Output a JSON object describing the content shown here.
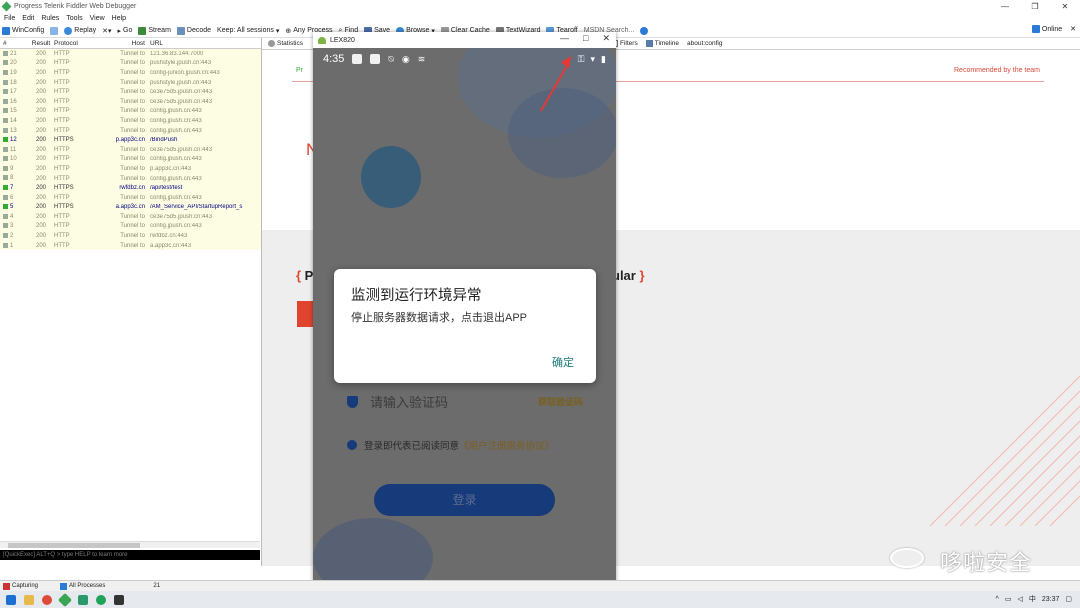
{
  "fiddler": {
    "title": "Progress Telerik Fiddler Web Debugger",
    "menu": [
      "File",
      "Edit",
      "Rules",
      "Tools",
      "View",
      "Help"
    ],
    "toolbar": {
      "winconfig": "WinConfig",
      "replay": "Replay",
      "go": "Go",
      "stream": "Stream",
      "decode": "Decode",
      "keep": "Keep: All sessions",
      "any_process": "Any Process",
      "find": "Find",
      "save": "Save",
      "browse": "Browse",
      "clear_cache": "Clear Cache",
      "textwizard": "TextWizard",
      "tearoff": "Tearoff",
      "msdn_search": "MSDN Search...",
      "online": "Online"
    },
    "columns": [
      "#",
      "Result",
      "Protocol",
      "Host",
      "URL"
    ],
    "sessions": [
      {
        "id": "21",
        "result": "200",
        "protocol": "HTTP",
        "host": "Tunnel to",
        "url": "121.36.83.144:7000",
        "https": false
      },
      {
        "id": "20",
        "result": "200",
        "protocol": "HTTP",
        "host": "Tunnel to",
        "url": "pushstyle.jpush.cn:443",
        "https": false
      },
      {
        "id": "19",
        "result": "200",
        "protocol": "HTTP",
        "host": "Tunnel to",
        "url": "config-junion.jpush.cn:443",
        "https": false
      },
      {
        "id": "18",
        "result": "200",
        "protocol": "HTTP",
        "host": "Tunnel to",
        "url": "pushstyle.jpush.cn:443",
        "https": false
      },
      {
        "id": "17",
        "result": "200",
        "protocol": "HTTP",
        "host": "Tunnel to",
        "url": "ce3e75d5.jpush.cn:443",
        "https": false
      },
      {
        "id": "16",
        "result": "200",
        "protocol": "HTTP",
        "host": "Tunnel to",
        "url": "ce3e75d5.jpush.cn:443",
        "https": false
      },
      {
        "id": "15",
        "result": "200",
        "protocol": "HTTP",
        "host": "Tunnel to",
        "url": "config.jpush.cn:443",
        "https": false
      },
      {
        "id": "14",
        "result": "200",
        "protocol": "HTTP",
        "host": "Tunnel to",
        "url": "config.jpush.cn:443",
        "https": false
      },
      {
        "id": "13",
        "result": "200",
        "protocol": "HTTP",
        "host": "Tunnel to",
        "url": "config.jpush.cn:443",
        "https": false
      },
      {
        "id": "12",
        "result": "200",
        "protocol": "HTTPS",
        "host": "p.app3c.cn",
        "url": "/BindPush",
        "https": true
      },
      {
        "id": "11",
        "result": "200",
        "protocol": "HTTP",
        "host": "Tunnel to",
        "url": "ce3e75d5.jpush.cn:443",
        "https": false
      },
      {
        "id": "10",
        "result": "200",
        "protocol": "HTTP",
        "host": "Tunnel to",
        "url": "config.jpush.cn:443",
        "https": false
      },
      {
        "id": "9",
        "result": "200",
        "protocol": "HTTP",
        "host": "Tunnel to",
        "url": "p.app3c.cn:443",
        "https": false
      },
      {
        "id": "8",
        "result": "200",
        "protocol": "HTTP",
        "host": "Tunnel to",
        "url": "config.jpush.cn:443",
        "https": false
      },
      {
        "id": "7",
        "result": "200",
        "protocol": "HTTPS",
        "host": "rwfdbz.cn",
        "url": "/api/test/test",
        "https": true
      },
      {
        "id": "6",
        "result": "200",
        "protocol": "HTTP",
        "host": "Tunnel to",
        "url": "config.jpush.cn:443",
        "https": false
      },
      {
        "id": "5",
        "result": "200",
        "protocol": "HTTPS",
        "host": "a.app3c.cn",
        "url": "/AM_Service_API/StartupReport_s",
        "https": true
      },
      {
        "id": "4",
        "result": "200",
        "protocol": "HTTP",
        "host": "Tunnel to",
        "url": "ce3e75d5.jpush.cn:443",
        "https": false
      },
      {
        "id": "3",
        "result": "200",
        "protocol": "HTTP",
        "host": "Tunnel to",
        "url": "config.jpush.cn:443",
        "https": false
      },
      {
        "id": "2",
        "result": "200",
        "protocol": "HTTP",
        "host": "Tunnel to",
        "url": "rwfdbz.cn:443",
        "https": false
      },
      {
        "id": "1",
        "result": "200",
        "protocol": "HTTP",
        "host": "Tunnel to",
        "url": "a.app3c.cn:443",
        "https": false
      }
    ],
    "quickexec": "[QuickExec] ALT+Q > type HELP to learn more",
    "tabs": {
      "statistics": "Statistics",
      "filters": "Filters",
      "timeline": "Timeline",
      "aboutconfig": "about:config"
    },
    "right_pane": {
      "recommended": "Recommended by the team",
      "letter_m": "N",
      "partial_left": "P",
      "partial_right": "ular",
      "partial_top": "Pr"
    },
    "status": {
      "capturing": "Capturing",
      "processes": "All Processes",
      "count": "21"
    }
  },
  "emulator": {
    "window_title": "LEX820",
    "time": "4:35",
    "field_placeholder": "请输入验证码",
    "get_code": "获取验证码",
    "agree_text": "登录即代表已阅读同意",
    "agree_link": "《用户注册服务协议》",
    "login_button": "登录",
    "dialog": {
      "title": "监测到运行环境异常",
      "message": "停止服务器数据请求，点击退出APP",
      "confirm": "确定"
    }
  },
  "taskbar": {
    "clock": "23:37"
  },
  "watermark": {
    "text": "哆啦安全"
  },
  "colors": {
    "accent_red": "#e0442f",
    "dialog_button": "#1a7a7a",
    "session_bg": "#fdfde4",
    "https_text": "#000080"
  }
}
